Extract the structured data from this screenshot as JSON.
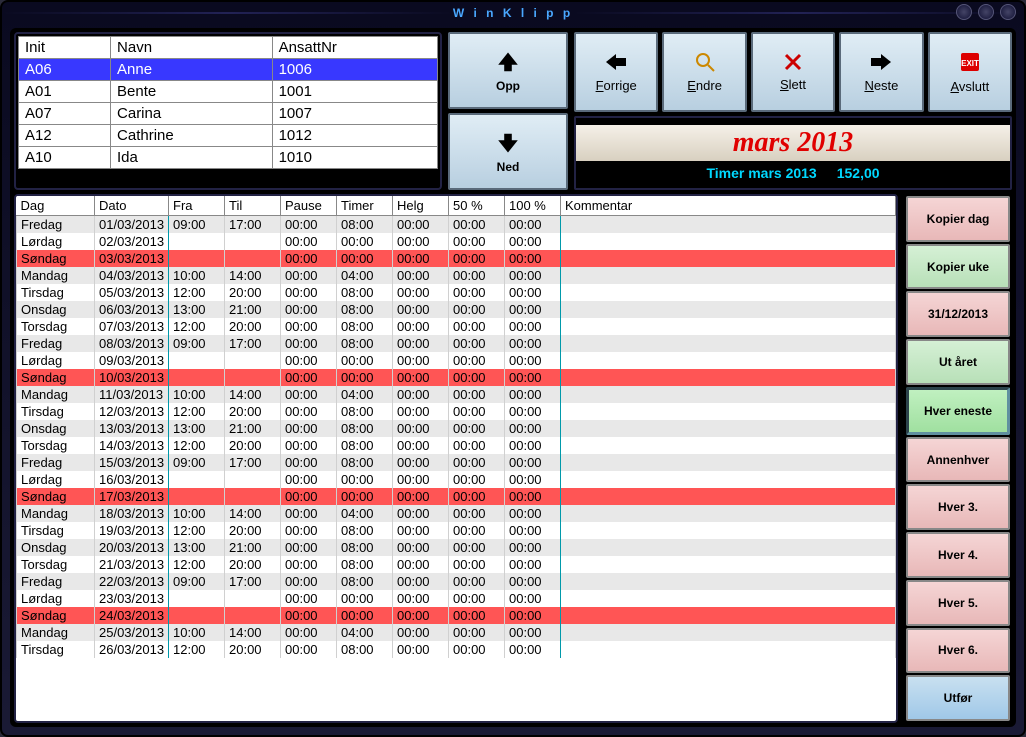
{
  "title": "W i n K l i p p",
  "employee_table": {
    "headers": [
      "Init",
      "Navn",
      "AnsattNr"
    ],
    "rows": [
      {
        "init": "A06",
        "navn": "Anne",
        "nr": "1006",
        "selected": true
      },
      {
        "init": "A01",
        "navn": "Bente",
        "nr": "1001"
      },
      {
        "init": "A07",
        "navn": "Carina",
        "nr": "1007"
      },
      {
        "init": "A12",
        "navn": "Cathrine",
        "nr": "1012"
      },
      {
        "init": "A10",
        "navn": "Ida",
        "nr": "1010"
      }
    ]
  },
  "nav": {
    "up": "Opp",
    "down": "Ned"
  },
  "actions": {
    "forrige": "Forrige",
    "endre": "Endre",
    "slett": "Slett",
    "neste": "Neste",
    "avslutt": "Avslutt"
  },
  "month_title": "mars 2013",
  "timer_label": "Timer mars  2013",
  "timer_value": "152,00",
  "grid_headers": [
    "Dag",
    "Dato",
    "Fra",
    "Til",
    "Pause",
    "Timer",
    "Helg",
    "50 %",
    "100 %",
    "Kommentar"
  ],
  "grid_rows": [
    {
      "dag": "Fredag",
      "dato": "01/03/2013",
      "fra": "09:00",
      "til": "17:00",
      "pause": "00:00",
      "timer": "08:00",
      "helg": "00:00",
      "p50": "00:00",
      "p100": "00:00",
      "cls": "even"
    },
    {
      "dag": "Lørdag",
      "dato": "02/03/2013",
      "fra": "",
      "til": "",
      "pause": "00:00",
      "timer": "00:00",
      "helg": "00:00",
      "p50": "00:00",
      "p100": "00:00",
      "cls": ""
    },
    {
      "dag": "Søndag",
      "dato": "03/03/2013",
      "fra": "",
      "til": "",
      "pause": "00:00",
      "timer": "00:00",
      "helg": "00:00",
      "p50": "00:00",
      "p100": "00:00",
      "cls": "sun"
    },
    {
      "dag": "Mandag",
      "dato": "04/03/2013",
      "fra": "10:00",
      "til": "14:00",
      "pause": "00:00",
      "timer": "04:00",
      "helg": "00:00",
      "p50": "00:00",
      "p100": "00:00",
      "cls": "even"
    },
    {
      "dag": "Tirsdag",
      "dato": "05/03/2013",
      "fra": "12:00",
      "til": "20:00",
      "pause": "00:00",
      "timer": "08:00",
      "helg": "00:00",
      "p50": "00:00",
      "p100": "00:00",
      "cls": ""
    },
    {
      "dag": "Onsdag",
      "dato": "06/03/2013",
      "fra": "13:00",
      "til": "21:00",
      "pause": "00:00",
      "timer": "08:00",
      "helg": "00:00",
      "p50": "00:00",
      "p100": "00:00",
      "cls": "even"
    },
    {
      "dag": "Torsdag",
      "dato": "07/03/2013",
      "fra": "12:00",
      "til": "20:00",
      "pause": "00:00",
      "timer": "08:00",
      "helg": "00:00",
      "p50": "00:00",
      "p100": "00:00",
      "cls": ""
    },
    {
      "dag": "Fredag",
      "dato": "08/03/2013",
      "fra": "09:00",
      "til": "17:00",
      "pause": "00:00",
      "timer": "08:00",
      "helg": "00:00",
      "p50": "00:00",
      "p100": "00:00",
      "cls": "even"
    },
    {
      "dag": "Lørdag",
      "dato": "09/03/2013",
      "fra": "",
      "til": "",
      "pause": "00:00",
      "timer": "00:00",
      "helg": "00:00",
      "p50": "00:00",
      "p100": "00:00",
      "cls": ""
    },
    {
      "dag": "Søndag",
      "dato": "10/03/2013",
      "fra": "",
      "til": "",
      "pause": "00:00",
      "timer": "00:00",
      "helg": "00:00",
      "p50": "00:00",
      "p100": "00:00",
      "cls": "sun"
    },
    {
      "dag": "Mandag",
      "dato": "11/03/2013",
      "fra": "10:00",
      "til": "14:00",
      "pause": "00:00",
      "timer": "04:00",
      "helg": "00:00",
      "p50": "00:00",
      "p100": "00:00",
      "cls": "even"
    },
    {
      "dag": "Tirsdag",
      "dato": "12/03/2013",
      "fra": "12:00",
      "til": "20:00",
      "pause": "00:00",
      "timer": "08:00",
      "helg": "00:00",
      "p50": "00:00",
      "p100": "00:00",
      "cls": ""
    },
    {
      "dag": "Onsdag",
      "dato": "13/03/2013",
      "fra": "13:00",
      "til": "21:00",
      "pause": "00:00",
      "timer": "08:00",
      "helg": "00:00",
      "p50": "00:00",
      "p100": "00:00",
      "cls": "even"
    },
    {
      "dag": "Torsdag",
      "dato": "14/03/2013",
      "fra": "12:00",
      "til": "20:00",
      "pause": "00:00",
      "timer": "08:00",
      "helg": "00:00",
      "p50": "00:00",
      "p100": "00:00",
      "cls": ""
    },
    {
      "dag": "Fredag",
      "dato": "15/03/2013",
      "fra": "09:00",
      "til": "17:00",
      "pause": "00:00",
      "timer": "08:00",
      "helg": "00:00",
      "p50": "00:00",
      "p100": "00:00",
      "cls": "even"
    },
    {
      "dag": "Lørdag",
      "dato": "16/03/2013",
      "fra": "",
      "til": "",
      "pause": "00:00",
      "timer": "00:00",
      "helg": "00:00",
      "p50": "00:00",
      "p100": "00:00",
      "cls": ""
    },
    {
      "dag": "Søndag",
      "dato": "17/03/2013",
      "fra": "",
      "til": "",
      "pause": "00:00",
      "timer": "00:00",
      "helg": "00:00",
      "p50": "00:00",
      "p100": "00:00",
      "cls": "sun"
    },
    {
      "dag": "Mandag",
      "dato": "18/03/2013",
      "fra": "10:00",
      "til": "14:00",
      "pause": "00:00",
      "timer": "04:00",
      "helg": "00:00",
      "p50": "00:00",
      "p100": "00:00",
      "cls": "even"
    },
    {
      "dag": "Tirsdag",
      "dato": "19/03/2013",
      "fra": "12:00",
      "til": "20:00",
      "pause": "00:00",
      "timer": "08:00",
      "helg": "00:00",
      "p50": "00:00",
      "p100": "00:00",
      "cls": ""
    },
    {
      "dag": "Onsdag",
      "dato": "20/03/2013",
      "fra": "13:00",
      "til": "21:00",
      "pause": "00:00",
      "timer": "08:00",
      "helg": "00:00",
      "p50": "00:00",
      "p100": "00:00",
      "cls": "even"
    },
    {
      "dag": "Torsdag",
      "dato": "21/03/2013",
      "fra": "12:00",
      "til": "20:00",
      "pause": "00:00",
      "timer": "08:00",
      "helg": "00:00",
      "p50": "00:00",
      "p100": "00:00",
      "cls": ""
    },
    {
      "dag": "Fredag",
      "dato": "22/03/2013",
      "fra": "09:00",
      "til": "17:00",
      "pause": "00:00",
      "timer": "08:00",
      "helg": "00:00",
      "p50": "00:00",
      "p100": "00:00",
      "cls": "even"
    },
    {
      "dag": "Lørdag",
      "dato": "23/03/2013",
      "fra": "",
      "til": "",
      "pause": "00:00",
      "timer": "00:00",
      "helg": "00:00",
      "p50": "00:00",
      "p100": "00:00",
      "cls": ""
    },
    {
      "dag": "Søndag",
      "dato": "24/03/2013",
      "fra": "",
      "til": "",
      "pause": "00:00",
      "timer": "00:00",
      "helg": "00:00",
      "p50": "00:00",
      "p100": "00:00",
      "cls": "sun"
    },
    {
      "dag": "Mandag",
      "dato": "25/03/2013",
      "fra": "10:00",
      "til": "14:00",
      "pause": "00:00",
      "timer": "04:00",
      "helg": "00:00",
      "p50": "00:00",
      "p100": "00:00",
      "cls": "even"
    },
    {
      "dag": "Tirsdag",
      "dato": "26/03/2013",
      "fra": "12:00",
      "til": "20:00",
      "pause": "00:00",
      "timer": "08:00",
      "helg": "00:00",
      "p50": "00:00",
      "p100": "00:00",
      "cls": ""
    }
  ],
  "side_buttons": [
    {
      "label": "Kopier dag",
      "cls": "c-pink"
    },
    {
      "label": "Kopier uke",
      "cls": "c-green"
    },
    {
      "label": "31/12/2013",
      "cls": "c-pink"
    },
    {
      "label": "Ut året",
      "cls": "c-green"
    },
    {
      "label": "Hver eneste",
      "cls": "c-green-sel"
    },
    {
      "label": "Annenhver",
      "cls": "c-pink"
    },
    {
      "label": "Hver 3.",
      "cls": "c-pink"
    },
    {
      "label": "Hver 4.",
      "cls": "c-pink"
    },
    {
      "label": "Hver 5.",
      "cls": "c-pink"
    },
    {
      "label": "Hver 6.",
      "cls": "c-pink"
    },
    {
      "label": "Utfør",
      "cls": "c-blue"
    }
  ]
}
